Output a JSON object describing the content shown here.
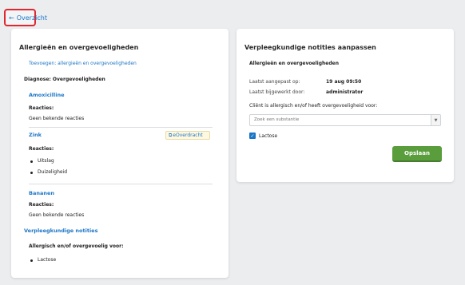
{
  "back": {
    "arrow": "←",
    "label": "Overzicht"
  },
  "left": {
    "title": "Allergieën en overgevoeligheden",
    "add_link": "Toevoegen: allergieën en overgevoeligheden",
    "diagnosis": "Diagnose: Overgevoeligheden",
    "items": [
      {
        "name": "Amoxicilline",
        "reactions_label": "Reacties:",
        "reactions": [
          "Geen bekende reacties"
        ]
      },
      {
        "name": "Zink",
        "badge": "eOverdracht",
        "reactions_label": "Reacties:",
        "reactions": [
          "Uitslag",
          "Duizeligheid"
        ]
      },
      {
        "name": "Bananen",
        "reactions_label": "Reacties:",
        "reactions": [
          "Geen bekende reacties"
        ]
      }
    ],
    "notes": {
      "title": "Verpleegkundige notities",
      "subtitle": "Allergisch en/of overgevoelig voor:",
      "values": [
        "Lactose"
      ]
    }
  },
  "right": {
    "title": "Verpleegkundige notities aanpassen",
    "section": "Allergieën en overgevoeligheden",
    "last_changed_label": "Laatst aangepast op:",
    "last_changed_value": "19 aug 09:50",
    "last_edited_label": "Laatst bijgewerkt door:",
    "last_edited_value": "administrator",
    "question": "Cliënt is allergisch en/of heeft overgevoeligheid voor:",
    "search_placeholder": "Zoek een substantie",
    "checkbox_label": "Lactose",
    "save_label": "Opslaan"
  },
  "colors": {
    "link": "#1b76c7",
    "save": "#5a9d3c",
    "highlight": "#e0262f",
    "badge_bg": "#fff8e0"
  },
  "icons": {
    "back": "arrow-left-icon",
    "badge": "transfer-document-icon",
    "dropdown": "chevron-down-icon",
    "check": "checkmark-icon"
  }
}
